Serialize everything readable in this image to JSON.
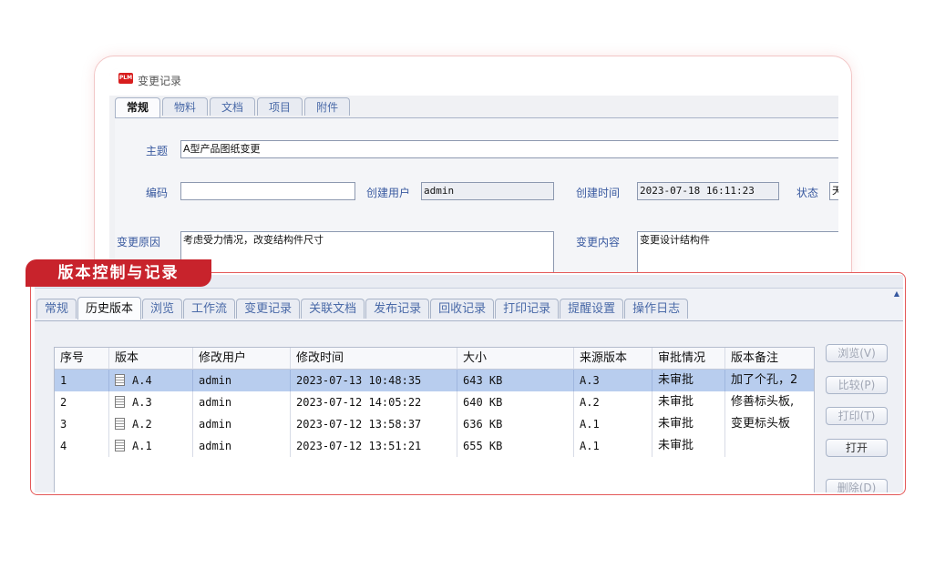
{
  "back_window": {
    "title": "变更记录",
    "tabs": [
      "常规",
      "物料",
      "文档",
      "项目",
      "附件"
    ],
    "fields": {
      "subject_label": "主题",
      "subject_value": "A型产品图纸变更",
      "code_label": "编码",
      "code_value": "",
      "creator_label": "创建用户",
      "creator_value": "admin",
      "created_time_label": "创建时间",
      "created_time_value": "2023-07-18 16:11:23",
      "status_label": "状态",
      "status_value": "天",
      "reason_label": "变更原因",
      "reason_value": "考虑受力情况，改变结构件尺寸",
      "content_label": "变更内容",
      "content_value": "变更设计结构件"
    }
  },
  "section_tag": "版本控制与记录",
  "front_window": {
    "tabs": [
      "常规",
      "历史版本",
      "浏览",
      "工作流",
      "变更记录",
      "关联文档",
      "发布记录",
      "回收记录",
      "打印记录",
      "提醒设置",
      "操作日志"
    ],
    "active_tab": "历史版本",
    "table": {
      "headers": [
        "序号",
        "版本",
        "修改用户",
        "修改时间",
        "大小",
        "来源版本",
        "审批情况",
        "版本备注"
      ],
      "rows": [
        {
          "no": "1",
          "version": "A.4",
          "user": "admin",
          "time": "2023-07-13 10:48:35",
          "size": "643 KB",
          "source": "A.3",
          "approval": "未审批",
          "remark": "加了个孔，2"
        },
        {
          "no": "2",
          "version": "A.3",
          "user": "admin",
          "time": "2023-07-12 14:05:22",
          "size": "640 KB",
          "source": "A.2",
          "approval": "未审批",
          "remark": "修善标头板,"
        },
        {
          "no": "3",
          "version": "A.2",
          "user": "admin",
          "time": "2023-07-12 13:58:37",
          "size": "636 KB",
          "source": "A.1",
          "approval": "未审批",
          "remark": "变更标头板"
        },
        {
          "no": "4",
          "version": "A.1",
          "user": "admin",
          "time": "2023-07-12 13:51:21",
          "size": "655 KB",
          "source": "A.1",
          "approval": "未审批",
          "remark": ""
        }
      ]
    },
    "buttons": {
      "browse": "浏览(V)",
      "compare": "比较(P)",
      "print": "打印(T)",
      "open": "打开",
      "delete": "删除(D)"
    }
  }
}
